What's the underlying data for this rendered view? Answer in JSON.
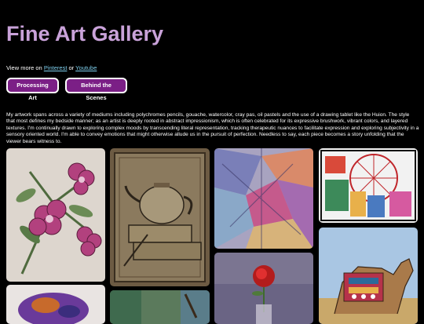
{
  "header": {
    "title": "Fine Art Gallery"
  },
  "links": {
    "prefix": "View more on ",
    "pinterest": "Pinterest",
    "joiner": " or ",
    "youtube": "Youtube"
  },
  "buttons": {
    "processing": "Processing Art",
    "behind": "Behind the Scenes"
  },
  "description": "My artwork spans across a variety of mediums including polychromes pencils, gouache, watercolor, cray pas, oil pastels and the use of a drawing tablet like the Huion. The style that most defines my bedside manner; as an artist is deeply rooted in abstract impressionism, which is often celebrated for its expressive brushwork, vibrant colors, and layered textures. I'm continually drawn to exploring complex moods by transcending literal representation, tracking therapeutic nuances to facilitate expression and exploring subjectivity in a sensory oriented world. I'm able to convey emotions that might otherwise allude us in the pursuit of perfection. Needless to say, each piece becomes a story unfolding that the viewer bears witness to.",
  "gallery": [
    {
      "subject": "pink flowers drawing"
    },
    {
      "subject": "teapot and books still life"
    },
    {
      "subject": "abstract colorful painting"
    },
    {
      "subject": "ferris wheel and tents"
    },
    {
      "subject": "decorated camel"
    },
    {
      "subject": "red rose in vase"
    },
    {
      "subject": "purple abstract figure"
    },
    {
      "subject": "green brushwork"
    }
  ],
  "colors": {
    "title": "#c9a2d9",
    "button_bg": "#7b1f86",
    "link": "#7fd0ee"
  }
}
